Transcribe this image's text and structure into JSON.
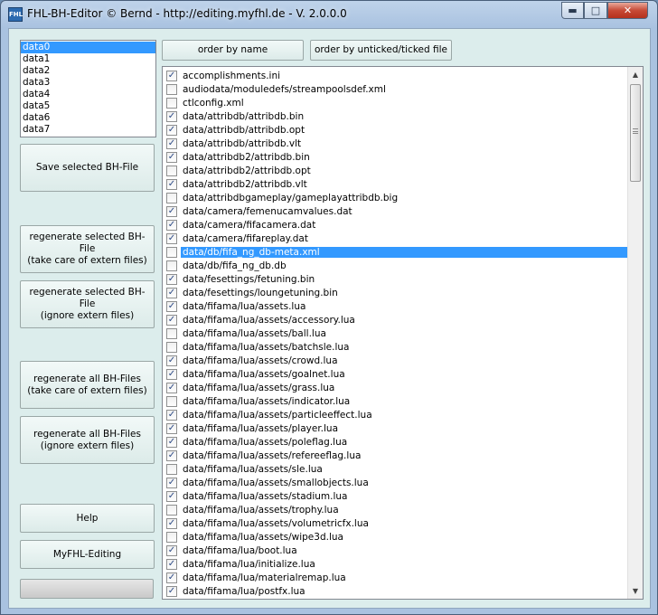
{
  "window": {
    "title": "FHL-BH-Editor © Bernd - http://editing.myfhl.de - V. 2.0.0.0",
    "icon_text": "FHL"
  },
  "data_list": {
    "items": [
      "data0",
      "data1",
      "data2",
      "data3",
      "data4",
      "data5",
      "data6",
      "data7"
    ],
    "selected": 0
  },
  "buttons": {
    "save": "Save selected BH-File",
    "regen_sel_care": "regenerate selected BH-File\n(take care of extern files)",
    "regen_sel_ignore": "regenerate selected BH-File\n(ignore extern files)",
    "regen_all_care": "regenerate all BH-Files\n(take care of extern files)",
    "regen_all_ignore": "regenerate all BH-Files\n(ignore extern files)",
    "help": "Help",
    "myfhl": "MyFHL-Editing",
    "order_name": "order by name",
    "order_ticked": "order by unticked/ticked file"
  },
  "progress": 0,
  "files": [
    {
      "name": "accomplishments.ini",
      "checked": true
    },
    {
      "name": "audiodata/moduledefs/streampoolsdef.xml",
      "checked": false
    },
    {
      "name": "ctlconfig.xml",
      "checked": false
    },
    {
      "name": "data/attribdb/attribdb.bin",
      "checked": true
    },
    {
      "name": "data/attribdb/attribdb.opt",
      "checked": true
    },
    {
      "name": "data/attribdb/attribdb.vlt",
      "checked": true
    },
    {
      "name": "data/attribdb2/attribdb.bin",
      "checked": true
    },
    {
      "name": "data/attribdb2/attribdb.opt",
      "checked": false
    },
    {
      "name": "data/attribdb2/attribdb.vlt",
      "checked": true
    },
    {
      "name": "data/attribdbgameplay/gameplayattribdb.big",
      "checked": false
    },
    {
      "name": "data/camera/femenucamvalues.dat",
      "checked": true
    },
    {
      "name": "data/camera/fifacamera.dat",
      "checked": true
    },
    {
      "name": "data/camera/fifareplay.dat",
      "checked": true
    },
    {
      "name": "data/db/fifa_ng_db-meta.xml",
      "checked": false,
      "selected": true
    },
    {
      "name": "data/db/fifa_ng_db.db",
      "checked": false
    },
    {
      "name": "data/fesettings/fetuning.bin",
      "checked": true
    },
    {
      "name": "data/fesettings/loungetuning.bin",
      "checked": true
    },
    {
      "name": "data/fifama/lua/assets.lua",
      "checked": true
    },
    {
      "name": "data/fifama/lua/assets/accessory.lua",
      "checked": true
    },
    {
      "name": "data/fifama/lua/assets/ball.lua",
      "checked": false
    },
    {
      "name": "data/fifama/lua/assets/batchsle.lua",
      "checked": false
    },
    {
      "name": "data/fifama/lua/assets/crowd.lua",
      "checked": true
    },
    {
      "name": "data/fifama/lua/assets/goalnet.lua",
      "checked": true
    },
    {
      "name": "data/fifama/lua/assets/grass.lua",
      "checked": true
    },
    {
      "name": "data/fifama/lua/assets/indicator.lua",
      "checked": false
    },
    {
      "name": "data/fifama/lua/assets/particleeffect.lua",
      "checked": true
    },
    {
      "name": "data/fifama/lua/assets/player.lua",
      "checked": true
    },
    {
      "name": "data/fifama/lua/assets/poleflag.lua",
      "checked": true
    },
    {
      "name": "data/fifama/lua/assets/refereeflag.lua",
      "checked": true
    },
    {
      "name": "data/fifama/lua/assets/sle.lua",
      "checked": false
    },
    {
      "name": "data/fifama/lua/assets/smallobjects.lua",
      "checked": true
    },
    {
      "name": "data/fifama/lua/assets/stadium.lua",
      "checked": true
    },
    {
      "name": "data/fifama/lua/assets/trophy.lua",
      "checked": false
    },
    {
      "name": "data/fifama/lua/assets/volumetricfx.lua",
      "checked": true
    },
    {
      "name": "data/fifama/lua/assets/wipe3d.lua",
      "checked": false
    },
    {
      "name": "data/fifama/lua/boot.lua",
      "checked": true
    },
    {
      "name": "data/fifama/lua/initialize.lua",
      "checked": true
    },
    {
      "name": "data/fifama/lua/materialremap.lua",
      "checked": true
    },
    {
      "name": "data/fifama/lua/postfx.lua",
      "checked": true
    }
  ],
  "icons": {
    "check": "✓",
    "minimize": "▬",
    "maximize": "□",
    "close": "✕",
    "scroll_up": "▲",
    "scroll_down": "▼"
  },
  "colors": {
    "selection": "#3399ff",
    "client_bg": "#dcedec",
    "progress_fill": "#3ac43a"
  }
}
